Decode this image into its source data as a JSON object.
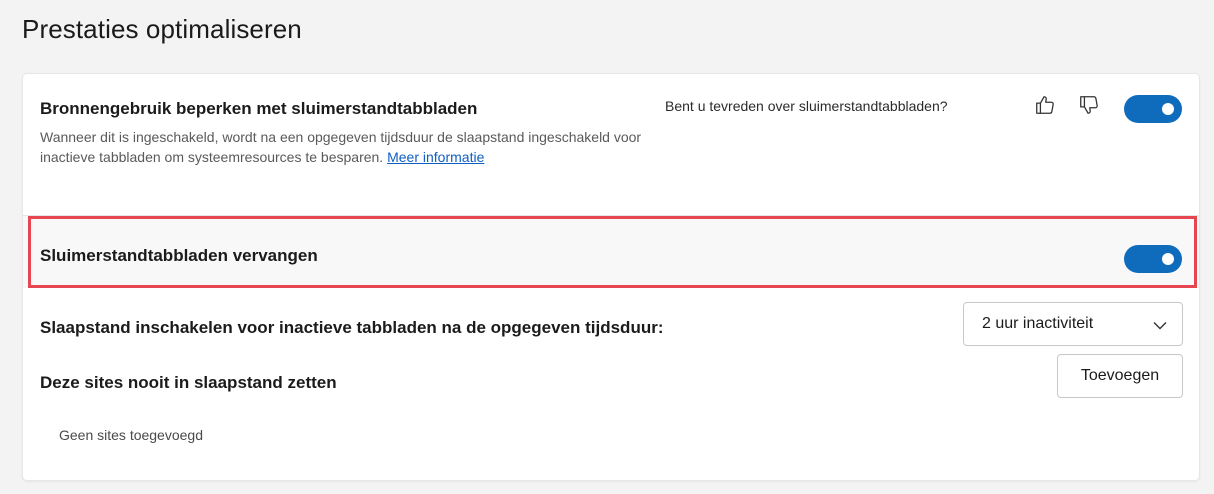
{
  "page": {
    "title": "Prestaties optimaliseren"
  },
  "sleeping_tabs": {
    "title": "Bronnengebruik beperken met sluimerstandtabbladen",
    "description": "Wanneer dit is ingeschakeld, wordt na een opgegeven tijdsduur de slaapstand ingeschakeld voor inactieve tabbladen om systeemresources te besparen.",
    "learn_more": "Meer informatie",
    "feedback_question": "Bent u tevreden over sluimerstandtabbladen?",
    "enabled": true
  },
  "replace_tabs": {
    "label": "Sluimerstandtabbladen vervangen",
    "enabled": true
  },
  "sleep_timeout": {
    "label": "Slaapstand inschakelen voor inactieve tabbladen na de opgegeven tijdsduur:",
    "selected": "2 uur inactiviteit"
  },
  "never_sleep": {
    "label": "Deze sites nooit in slaapstand zetten",
    "add_button": "Toevoegen",
    "empty_text": "Geen sites toegevoegd"
  },
  "colors": {
    "accent": "#0f6cbd",
    "highlight": "#e64650",
    "link": "#0f5fc2"
  }
}
